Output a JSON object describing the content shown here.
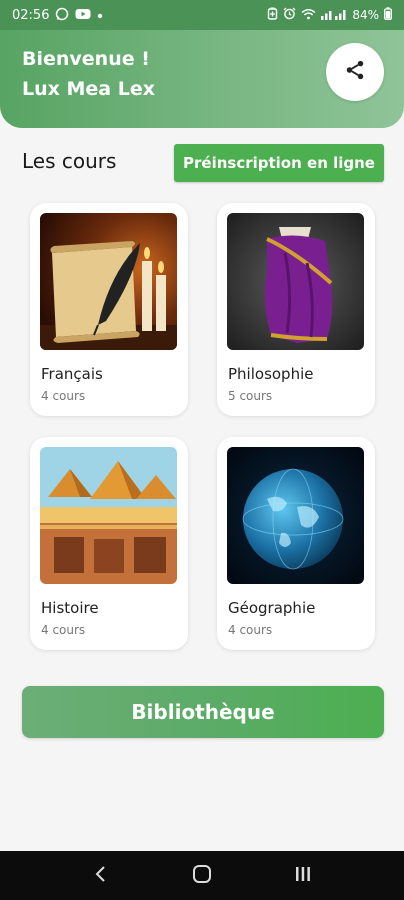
{
  "status_bar": {
    "time": "02:56",
    "battery": "84%",
    "icons": [
      "whatsapp-icon",
      "youtube-icon",
      "dot-icon",
      "battery-saver-icon",
      "alarm-icon",
      "wifi-icon",
      "signal-icon",
      "battery-icon"
    ]
  },
  "header": {
    "greeting_line1": "Bienvenue !",
    "greeting_line2": "Lux Mea Lex",
    "share_icon": "share-icon"
  },
  "courses_section": {
    "title": "Les cours",
    "preregistration_label": "Préinscription en ligne"
  },
  "courses": [
    {
      "name": "Français",
      "count": "4 cours",
      "image": "parchment-quill-candles"
    },
    {
      "name": "Philosophie",
      "count": "5 cours",
      "image": "purple-toga"
    },
    {
      "name": "Histoire",
      "count": "4 cours",
      "image": "pyramids-desert"
    },
    {
      "name": "Géographie",
      "count": "4 cours",
      "image": "digital-globe"
    }
  ],
  "library_button": {
    "label": "Bibliothèque"
  },
  "nav_bar": {
    "icons": [
      "back-icon",
      "home-icon",
      "recents-icon"
    ]
  },
  "colors": {
    "status_bar": "#4a9256",
    "header_start": "#57a463",
    "header_end": "#8fc498",
    "accent_green": "#4caf50",
    "background": "#f5f5f5",
    "nav_bar": "#0c0c0c"
  }
}
